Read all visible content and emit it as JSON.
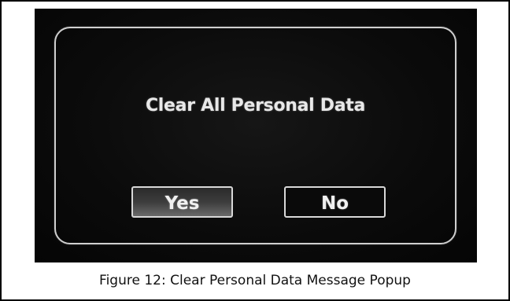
{
  "dialog": {
    "message": "Clear All Personal Data",
    "yes_label": "Yes",
    "no_label": "No"
  },
  "caption": "Figure 12: Clear Personal Data Message Popup",
  "colors": {
    "screen_background": "#0b0b0b",
    "dialog_border": "#cfcfcf",
    "text": "#e8e8e8",
    "caption_text": "#111111"
  }
}
